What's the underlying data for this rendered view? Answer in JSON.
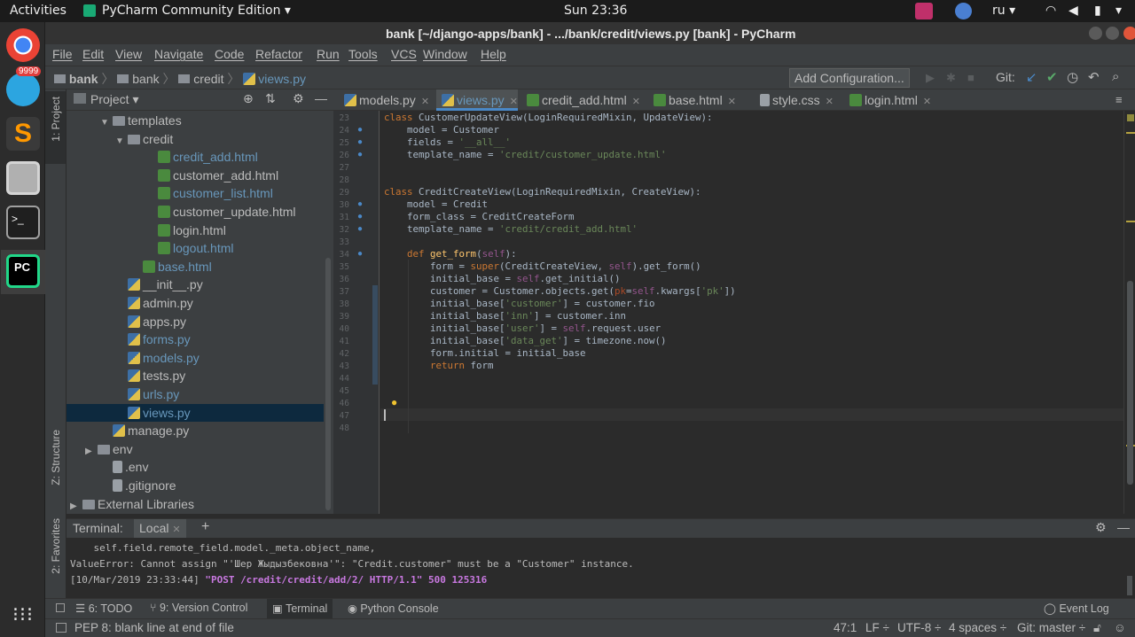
{
  "topbar": {
    "activities": "Activities",
    "app_name": "PyCharm Community Edition",
    "clock": "Sun 23:36",
    "lang": "ru"
  },
  "dock": {
    "telegram_badge": "9999"
  },
  "window": {
    "title": "bank [~/django-apps/bank] - .../bank/credit/views.py [bank] - PyCharm"
  },
  "menu": [
    "File",
    "Edit",
    "View",
    "Navigate",
    "Code",
    "Refactor",
    "Run",
    "Tools",
    "VCS",
    "Window",
    "Help"
  ],
  "breadcrumb": [
    "bank",
    "bank",
    "credit",
    "views.py"
  ],
  "toolbar": {
    "add_config": "Add Configuration...",
    "git_label": "Git:"
  },
  "left_stripe": {
    "project": "1: Project",
    "structure": "Z: Structure",
    "favorites": "2: Favorites"
  },
  "project": {
    "title": "Project",
    "tree": [
      {
        "label": "templates",
        "type": "folder",
        "indent": 2,
        "open": true
      },
      {
        "label": "credit",
        "type": "folder",
        "indent": 3,
        "open": true
      },
      {
        "label": "credit_add.html",
        "type": "html",
        "indent": 5,
        "color": "#6897bb"
      },
      {
        "label": "customer_add.html",
        "type": "html",
        "indent": 5,
        "color": "#bbbbbb"
      },
      {
        "label": "customer_list.html",
        "type": "html",
        "indent": 5,
        "color": "#6897bb"
      },
      {
        "label": "customer_update.html",
        "type": "html",
        "indent": 5,
        "color": "#bbbbbb"
      },
      {
        "label": "login.html",
        "type": "html",
        "indent": 5,
        "color": "#bbbbbb"
      },
      {
        "label": "logout.html",
        "type": "html",
        "indent": 5,
        "color": "#6897bb"
      },
      {
        "label": "base.html",
        "type": "html",
        "indent": 4,
        "color": "#6897bb"
      },
      {
        "label": "__init__.py",
        "type": "py",
        "indent": 3,
        "color": "#bbbbbb"
      },
      {
        "label": "admin.py",
        "type": "py",
        "indent": 3,
        "color": "#bbbbbb"
      },
      {
        "label": "apps.py",
        "type": "py",
        "indent": 3,
        "color": "#bbbbbb"
      },
      {
        "label": "forms.py",
        "type": "py",
        "indent": 3,
        "color": "#6897bb"
      },
      {
        "label": "models.py",
        "type": "py",
        "indent": 3,
        "color": "#6897bb"
      },
      {
        "label": "tests.py",
        "type": "py",
        "indent": 3,
        "color": "#bbbbbb"
      },
      {
        "label": "urls.py",
        "type": "py",
        "indent": 3,
        "color": "#6897bb"
      },
      {
        "label": "views.py",
        "type": "py",
        "indent": 3,
        "color": "#6897bb",
        "selected": true
      },
      {
        "label": "manage.py",
        "type": "py",
        "indent": 2,
        "color": "#bbbbbb"
      },
      {
        "label": "env",
        "type": "folder",
        "indent": 1,
        "open": false
      },
      {
        "label": ".env",
        "type": "file",
        "indent": 2,
        "color": "#bbbbbb"
      },
      {
        "label": ".gitignore",
        "type": "file",
        "indent": 2,
        "color": "#bbbbbb"
      },
      {
        "label": "External Libraries",
        "type": "lib",
        "indent": 0,
        "open": false
      }
    ]
  },
  "editor": {
    "tabs": [
      {
        "label": "models.py",
        "active": false
      },
      {
        "label": "views.py",
        "active": true
      },
      {
        "label": "credit_add.html",
        "active": false
      },
      {
        "label": "base.html",
        "active": false
      },
      {
        "label": "style.css",
        "active": false
      },
      {
        "label": "login.html",
        "active": false
      }
    ],
    "lines": [
      {
        "n": "23",
        "html": "<span class=\"kw\">class</span> CustomerUpdateView(LoginRequiredMixin, UpdateView):"
      },
      {
        "n": "24",
        "html": "    model = Customer"
      },
      {
        "n": "25",
        "html": "    fields = <span class=\"str\">'__all__'</span>"
      },
      {
        "n": "26",
        "html": "    template_name = <span class=\"str\">'credit/customer_update.html'</span>"
      },
      {
        "n": "27",
        "html": ""
      },
      {
        "n": "28",
        "html": ""
      },
      {
        "n": "29",
        "html": "<span class=\"kw\">class</span> CreditCreateView(LoginRequiredMixin, CreateView):"
      },
      {
        "n": "30",
        "html": "    model = Credit"
      },
      {
        "n": "31",
        "html": "    form_class = CreditCreateForm"
      },
      {
        "n": "32",
        "html": "    template_name = <span class=\"str\">'credit/credit_add.html'</span>"
      },
      {
        "n": "33",
        "html": ""
      },
      {
        "n": "34",
        "html": "    <span class=\"kw\">def</span> <span class=\"fn\">get_form</span>(<span class=\"slf\">self</span>):"
      },
      {
        "n": "35",
        "html": "        form = <span class=\"kw\">super</span>(CreditCreateView, <span class=\"slf\">self</span>).get_form()"
      },
      {
        "n": "36",
        "html": "        initial_base = <span class=\"slf\">self</span>.get_initial()"
      },
      {
        "n": "37",
        "html": "        customer = Customer.objects.get(<span class=\"kwa\">pk</span>=<span class=\"slf\">self</span>.kwargs[<span class=\"str\">'pk'</span>])"
      },
      {
        "n": "38",
        "html": "        initial_base[<span class=\"str\">'customer'</span>] = customer.fio"
      },
      {
        "n": "39",
        "html": "        initial_base[<span class=\"str\">'inn'</span>] = customer.inn"
      },
      {
        "n": "40",
        "html": "        initial_base[<span class=\"str\">'user'</span>] = <span class=\"slf\">self</span>.request.user"
      },
      {
        "n": "41",
        "html": "        initial_base[<span class=\"str\">'data_get'</span>] = timezone.now()"
      },
      {
        "n": "42",
        "html": "        form.initial = initial_base"
      },
      {
        "n": "43",
        "html": "        <span class=\"kw\">return</span> form"
      },
      {
        "n": "44",
        "html": ""
      },
      {
        "n": "45",
        "html": ""
      },
      {
        "n": "46",
        "html": ""
      },
      {
        "n": "47",
        "html": ""
      },
      {
        "n": "48",
        "html": ""
      }
    ]
  },
  "terminal": {
    "label": "Terminal:",
    "tab": "Local",
    "lines": [
      "    self.field.remote_field.model._meta.object_name,",
      "ValueError: Cannot assign \"'Шер Жыдызбековна'\": \"Credit.customer\" must be a \"Customer\" instance."
    ],
    "last_prefix": "[10/Mar/2019 23:33:44] ",
    "last_request": "\"POST /credit/credit/add/2/ HTTP/1.1\"",
    "last_suffix": " 500 125316"
  },
  "bottom_tabs": [
    "6: TODO",
    "9: Version Control",
    "Terminal",
    "Python Console"
  ],
  "event_log": "Event Log",
  "status": {
    "message": "PEP 8: blank line at end of file",
    "position": "47:1",
    "line_sep": "LF ÷",
    "encoding": "UTF-8 ÷",
    "indent": "4 spaces ÷",
    "git": "Git: master ÷"
  },
  "colors": {
    "accent": "#4a88c7",
    "modified_file": "#6897bb"
  }
}
